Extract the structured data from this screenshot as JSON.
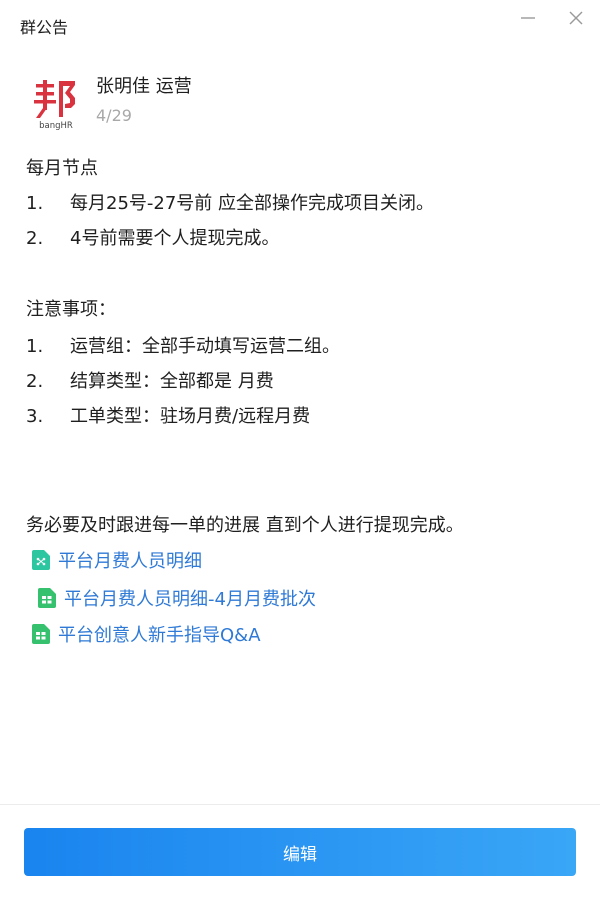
{
  "window": {
    "title": "群公告"
  },
  "author": {
    "name": "张明佳 运营",
    "date": "4/29",
    "avatar_text": "bangHR",
    "avatar_color": "#d9333f"
  },
  "announcement": {
    "section1_title": "每月节点",
    "section1_items": [
      {
        "num": "1.",
        "text": "每月25号-27号前 应全部操作完成项目关闭。"
      },
      {
        "num": "2.",
        "text": "4号前需要个人提现完成。"
      }
    ],
    "section2_title": "注意事项：",
    "section2_items": [
      {
        "num": "1.",
        "text": "运营组：全部手动填写运营二组。"
      },
      {
        "num": "2.",
        "text": "结算类型：全部都是 月费"
      },
      {
        "num": "3.",
        "text": "工单类型：驻场月费/远程月费"
      }
    ],
    "closing": "务必要及时跟进每一单的进展 直到个人进行提现完成。",
    "links": [
      {
        "text": "平台月费人员明细",
        "icon": "mindmap-doc-icon"
      },
      {
        "text": "平台月费人员明细-4月月费批次",
        "icon": "sheet-doc-icon"
      },
      {
        "text": "平台创意人新手指导Q&A",
        "icon": "sheet-doc-icon"
      }
    ]
  },
  "footer": {
    "edit_label": "编辑"
  },
  "colors": {
    "link": "#2f7ad6",
    "button": "#1a84ef",
    "doc_icon_teal": "#2cc6a0",
    "doc_icon_green": "#35c16e"
  }
}
